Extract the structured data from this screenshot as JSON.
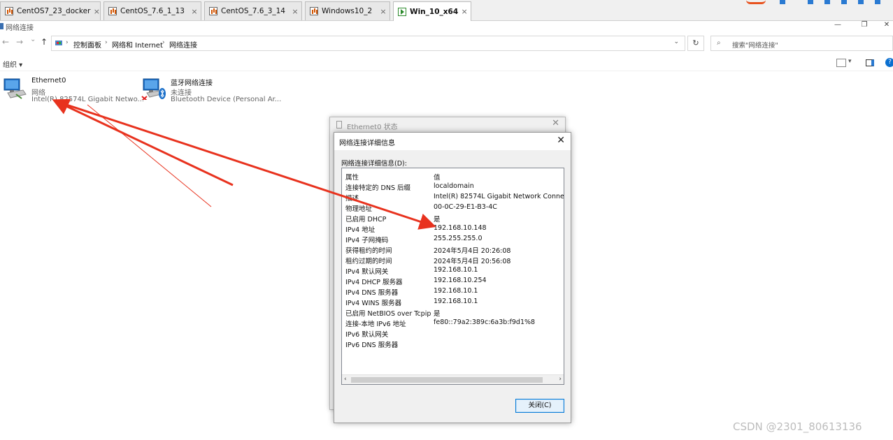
{
  "tabs": [
    {
      "label": "CentOS7_23_docker",
      "close": "×",
      "active": false
    },
    {
      "label": "CentOS_7.6_1_13",
      "close": "×",
      "active": false
    },
    {
      "label": "CentOS_7.6_3_14",
      "close": "×",
      "active": false
    },
    {
      "label": "Windows10_2",
      "close": "×",
      "active": false
    },
    {
      "label": "Win_10_x64",
      "close": "×",
      "active": true
    }
  ],
  "window": {
    "title": "网络连接",
    "minimize": "—",
    "restore": "❐",
    "close": "✕"
  },
  "nav": {
    "back": "←",
    "forward": "→",
    "recent": "⌄",
    "up": "↑",
    "dropdown": "⌄",
    "refresh": "↻"
  },
  "breadcrumb": [
    "控制面板",
    "网络和 Internet",
    "网络连接"
  ],
  "breadcrumb_sep": "›",
  "search": {
    "placeholder": "搜索\"网络连接\"",
    "icon": "search-icon"
  },
  "command_bar": {
    "organize": "组织 ▾"
  },
  "connections": [
    {
      "name": "Ethernet0",
      "status": "网络",
      "device": "Intel(R) 82574L Gigabit Netwo...",
      "icon": "network-adapter-icon"
    },
    {
      "name": "蓝牙网络连接",
      "status": "未连接",
      "device": "Bluetooth Device (Personal Ar...",
      "icon": "bluetooth-adapter-icon"
    }
  ],
  "status_dialog": {
    "title": "Ethernet0 状态",
    "close": "✕"
  },
  "details_dialog": {
    "title": "网络连接详细信息",
    "close": "✕",
    "list_label": "网络连接详细信息(D):",
    "header": {
      "property": "属性",
      "value": "值"
    },
    "rows": [
      {
        "k": "连接特定的 DNS 后缀",
        "v": "localdomain"
      },
      {
        "k": "描述",
        "v": "Intel(R) 82574L Gigabit Network Connect"
      },
      {
        "k": "物理地址",
        "v": "00-0C-29-E1-B3-4C"
      },
      {
        "k": "已启用 DHCP",
        "v": "是"
      },
      {
        "k": "IPv4 地址",
        "v": "192.168.10.148"
      },
      {
        "k": "IPv4 子网掩码",
        "v": "255.255.255.0"
      },
      {
        "k": "获得租约的时间",
        "v": "2024年5月4日 20:26:08"
      },
      {
        "k": "租约过期的时间",
        "v": "2024年5月4日 20:56:08"
      },
      {
        "k": "IPv4 默认网关",
        "v": "192.168.10.1"
      },
      {
        "k": "IPv4 DHCP 服务器",
        "v": "192.168.10.254"
      },
      {
        "k": "IPv4 DNS 服务器",
        "v": "192.168.10.1"
      },
      {
        "k": "IPv4 WINS 服务器",
        "v": "192.168.10.1"
      },
      {
        "k": "已启用 NetBIOS over Tcpip",
        "v": "是"
      },
      {
        "k": "连接-本地 IPv6 地址",
        "v": "fe80::79a2:389c:6a3b:f9d1%8"
      },
      {
        "k": "IPv6 默认网关",
        "v": ""
      },
      {
        "k": "IPv6 DNS 服务器",
        "v": ""
      }
    ],
    "scroll_left": "‹",
    "scroll_right": "›",
    "close_button": "关闭(C)"
  },
  "watermark": "CSDN @2301_80613136",
  "colors": {
    "annotation_arrow": "#e8321e",
    "selection_blue": "#0078d7"
  }
}
